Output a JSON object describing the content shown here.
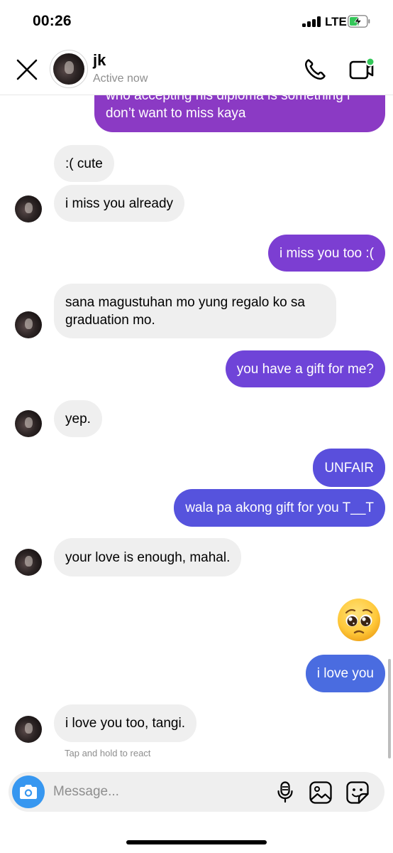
{
  "status_bar": {
    "time": "00:26",
    "network": "LTE",
    "battery_color": "#34c759"
  },
  "header": {
    "contact_name": "jk",
    "contact_status": "Active now",
    "icons": [
      "close-icon",
      "phone-icon",
      "video-camera-icon"
    ],
    "video_active_dot_color": "#34c759"
  },
  "messages": [
    {
      "from": "me",
      "text": "who accepting his diploma is something i don’t want to miss kaya"
    },
    {
      "from": "them",
      "text": ":( cute"
    },
    {
      "from": "them",
      "text": "i miss you already"
    },
    {
      "from": "me",
      "text": "i miss you too :("
    },
    {
      "from": "them",
      "text": "sana magustuhan mo yung regalo ko sa graduation mo."
    },
    {
      "from": "me",
      "text": "you have a gift for me?"
    },
    {
      "from": "them",
      "text": "yep."
    },
    {
      "from": "me",
      "text": "UNFAIR"
    },
    {
      "from": "me",
      "text": "wala pa akong gift for you T__T"
    },
    {
      "from": "them",
      "text": "your love is enough, mahal."
    },
    {
      "from": "me",
      "emoji": "pleading-face"
    },
    {
      "from": "me",
      "text": "i love you"
    },
    {
      "from": "them",
      "text": "i love you too, tangi."
    }
  ],
  "bubble_colors": {
    "incoming": "#efefef",
    "outgoing_purple": "#8b3ac4",
    "outgoing_violet": "#6f44d8",
    "outgoing_indigo": "#5b50dc",
    "outgoing_blue": "#4a6ce0"
  },
  "react_hint": "Tap and hold to react",
  "composer": {
    "placeholder": "Message...",
    "icons": [
      "camera-icon",
      "microphone-icon",
      "gallery-icon",
      "sticker-icon"
    ],
    "camera_color": "#3797f0"
  }
}
